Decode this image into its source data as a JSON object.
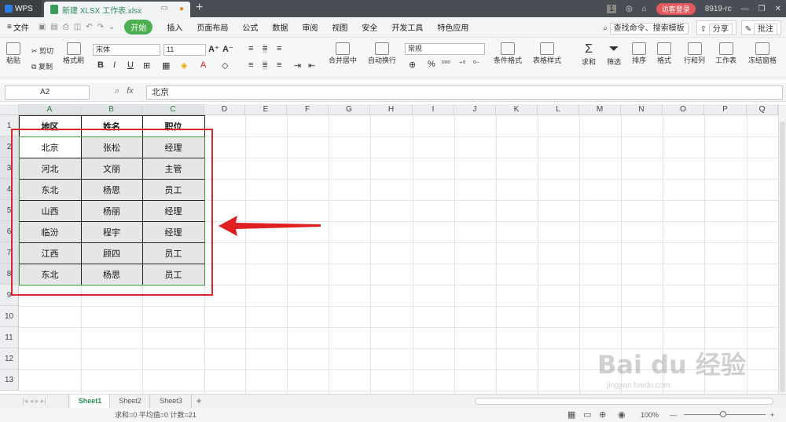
{
  "titlebar": {
    "app": "WPS",
    "file_tab": "新建 XLSX 工作表.xlsx",
    "new_tab": "+",
    "badge": "1",
    "login": "访客登录",
    "user": "8919-rc"
  },
  "menu": {
    "file": "文件",
    "start": "开始",
    "items": [
      "插入",
      "页面布局",
      "公式",
      "数据",
      "审阅",
      "视图",
      "安全",
      "开发工具",
      "特色应用"
    ],
    "search": "查找命令、搜索模板",
    "share": "分享",
    "comment": "批注"
  },
  "toolbar": {
    "paste": "粘贴",
    "cut": "剪切",
    "copy": "复制",
    "format_painter": "格式刷",
    "font": "宋体",
    "size": "11",
    "merge": "合并居中",
    "wrap": "自动换行",
    "number_format": "常规",
    "cond_format": "条件格式",
    "table_style": "表格样式",
    "sum": "求和",
    "filter": "筛选",
    "sort": "排序",
    "format": "格式",
    "rowcol": "行和列",
    "worksheet": "工作表",
    "freeze": "冻结窗格",
    "percent": "%"
  },
  "formula_bar": {
    "cell_ref": "A2",
    "fx": "fx",
    "content": "北京"
  },
  "grid": {
    "columns": [
      "A",
      "B",
      "C",
      "D",
      "E",
      "F",
      "G",
      "H",
      "I",
      "J",
      "K",
      "L",
      "M",
      "N",
      "O",
      "P",
      "Q"
    ],
    "rows": [
      "1",
      "2",
      "3",
      "4",
      "5",
      "6",
      "7",
      "8",
      "9",
      "10",
      "11",
      "12",
      "13"
    ],
    "header": [
      "地区",
      "姓名",
      "职位"
    ],
    "data": [
      [
        "北京",
        "张松",
        "经理"
      ],
      [
        "河北",
        "文丽",
        "主管"
      ],
      [
        "东北",
        "杨思",
        "员工"
      ],
      [
        "山西",
        "杨丽",
        "经理"
      ],
      [
        "临汾",
        "程宇",
        "经理"
      ],
      [
        "江西",
        "顾四",
        "员工"
      ],
      [
        "东北",
        "杨思",
        "员工"
      ]
    ]
  },
  "sheets": [
    "Sheet1",
    "Sheet2",
    "Sheet3"
  ],
  "status": {
    "summary": "求和=0  平均值=0  计数=21",
    "zoom": "100%"
  },
  "watermark": {
    "main": "Bai du 经验",
    "sub": "jingyan.baidu.com"
  },
  "colors": {
    "accent": "#4caf50",
    "highlight": "#d9272e"
  }
}
